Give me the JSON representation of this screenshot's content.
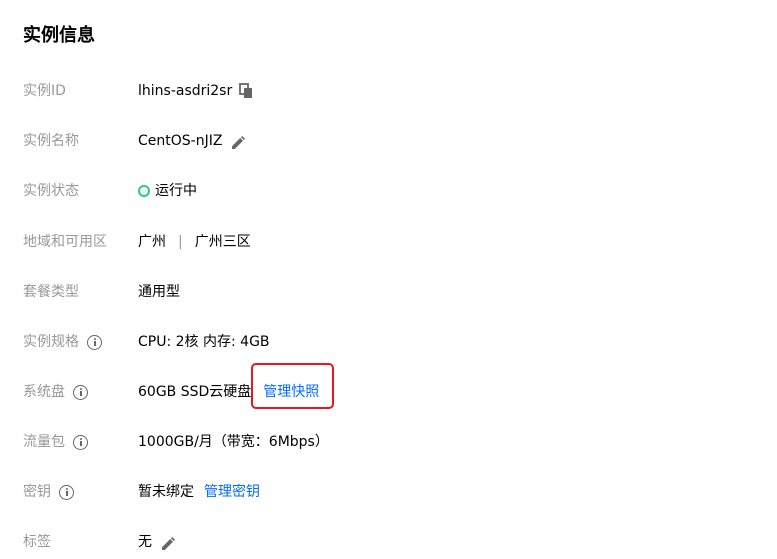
{
  "section": {
    "title": "实例信息"
  },
  "rows": {
    "instance_id": {
      "label": "实例ID",
      "value": "lhins-asdri2sr",
      "icon": "copy-icon"
    },
    "instance_name": {
      "label": "实例名称",
      "value": "CentOS-nJIZ",
      "icon": "edit-icon"
    },
    "instance_status": {
      "label": "实例状态",
      "value": "运行中",
      "status_color": "#29cc85"
    },
    "region": {
      "label": "地域和可用区",
      "region": "广州",
      "separator": "|",
      "zone": "广州三区"
    },
    "bundle_type": {
      "label": "套餐类型",
      "value": "通用型"
    },
    "instance_spec": {
      "label": "实例规格",
      "value": "CPU: 2核 内存: 4GB"
    },
    "system_disk": {
      "label": "系统盘",
      "value": "60GB SSD云硬盘",
      "link": "管理快照"
    },
    "traffic": {
      "label": "流量包",
      "value": "1000GB/月（带宽：6Mbps）"
    },
    "key": {
      "label": "密钥",
      "value": "暂未绑定",
      "link": "管理密钥"
    },
    "tags": {
      "label": "标签",
      "value": "无",
      "icon": "edit-icon"
    }
  },
  "colors": {
    "link": "#006eff",
    "highlight": "#e8171c",
    "label": "#999999"
  }
}
